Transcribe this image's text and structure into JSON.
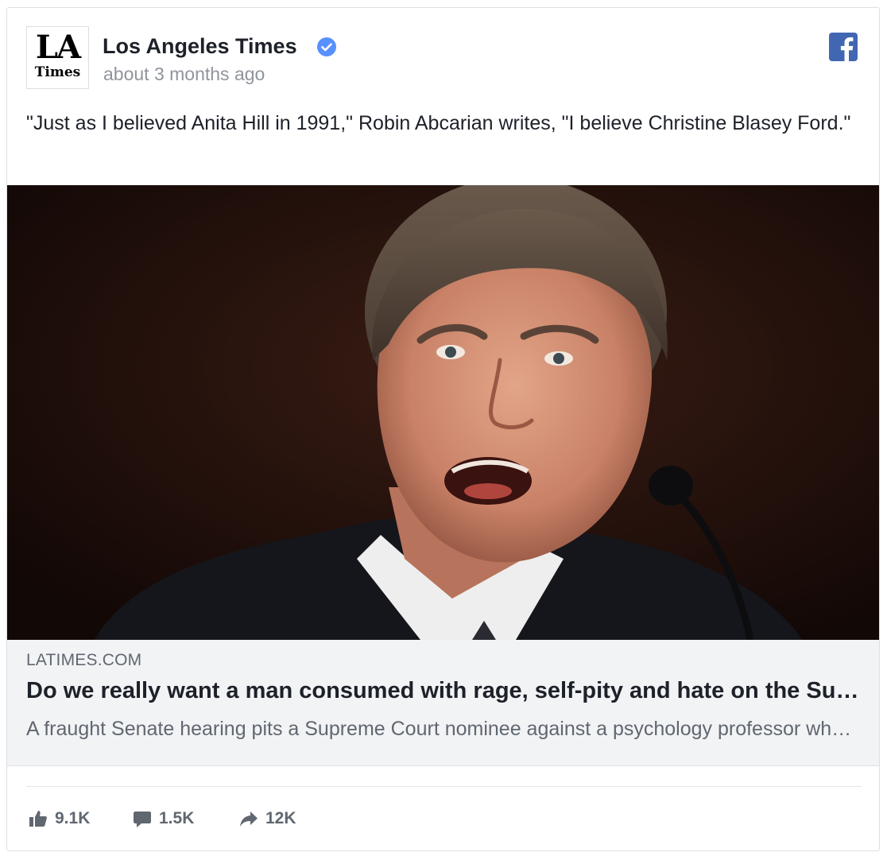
{
  "post": {
    "page_name": "Los Angeles Times",
    "timestamp": "about 3 months ago",
    "logo_text": {
      "line1": "LA",
      "line2": "Times"
    },
    "message": "\"Just as I believed Anita Hill in 1991,\" Robin Abcarian writes, \"I believe Christine Blasey Ford.\"",
    "verified_icon": "verified-badge-icon",
    "platform_icon": "facebook-icon"
  },
  "link_preview": {
    "domain": "LATIMES.COM",
    "title": "Do we really want a man consumed with rage, self-pity and hate on the Supreme Court?",
    "description": "A fraught Senate hearing pits a Supreme Court nominee against a psychology professor who accuses him of sexual assault."
  },
  "stats": {
    "likes": "9.1K",
    "comments": "1.5K",
    "shares": "12K",
    "like_icon": "thumbs-up-icon",
    "comment_icon": "comment-icon",
    "share_icon": "share-arrow-icon"
  },
  "colors": {
    "brand_blue": "#4267b2",
    "verified_blue": "#5890ff",
    "secondary_text": "#90949c",
    "link_box_bg": "#f2f3f5"
  }
}
